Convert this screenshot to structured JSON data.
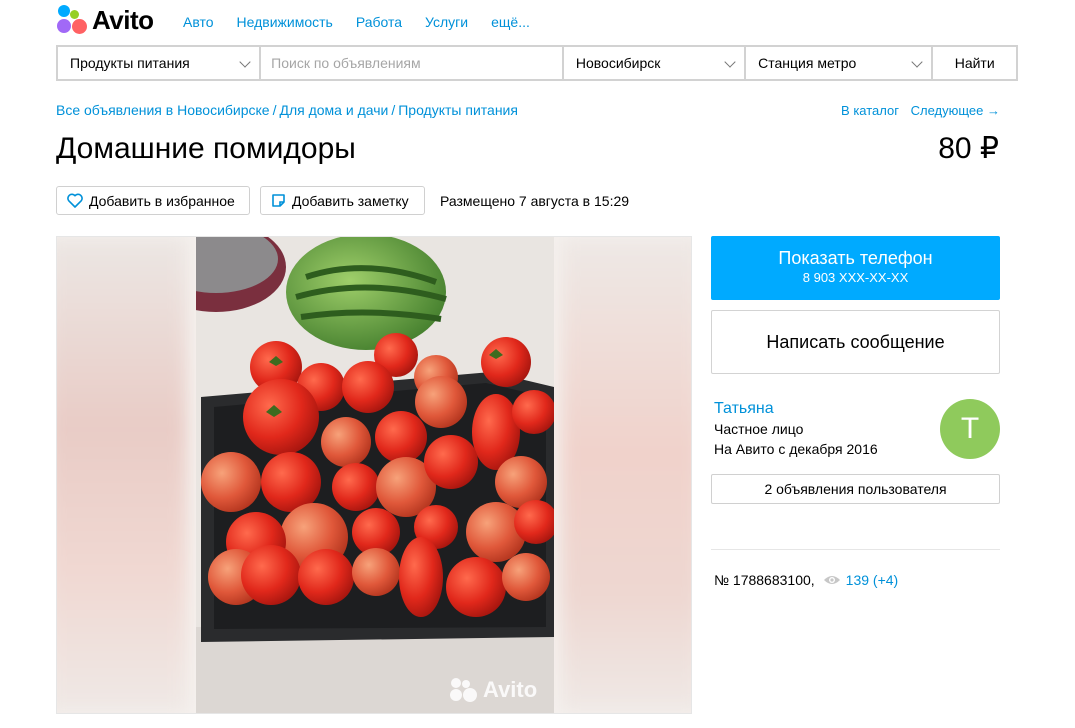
{
  "logo": {
    "text": "Avito"
  },
  "nav": [
    "Авто",
    "Недвижимость",
    "Работа",
    "Услуги",
    "ещё..."
  ],
  "search": {
    "category": "Продукты питания",
    "placeholder": "Поиск по объявлениям",
    "city": "Новосибирск",
    "metro": "Станция метро",
    "button": "Найти"
  },
  "breadcrumbs": [
    "Все объявления в Новосибирске",
    "Для дома и дачи",
    "Продукты питания"
  ],
  "breadcrumb_sep": "/",
  "catalog": {
    "to_catalog": "В каталог",
    "next": "Следующее →"
  },
  "listing": {
    "title": "Домашние помидоры",
    "price": "80 ₽",
    "favorite": "Добавить в избранное",
    "note": "Добавить заметку",
    "posted": "Размещено 7 августа в 15:29",
    "watermark": "Avito"
  },
  "contact": {
    "show_phone": "Показать телефон",
    "phone_masked": "8 903 XXX-XX-XX",
    "write_message": "Написать сообщение"
  },
  "seller": {
    "name": "Татьяна",
    "type": "Частное лицо",
    "since": "На Авито с декабря 2016",
    "avatar_letter": "Т",
    "ads_button": "2 объявления пользователя"
  },
  "stats": {
    "number": "№ 1788683100,",
    "views": "139 (+4)"
  },
  "colors": {
    "accent": "#00aaff",
    "link": "#0091d9",
    "avatar": "#8fca5c"
  }
}
